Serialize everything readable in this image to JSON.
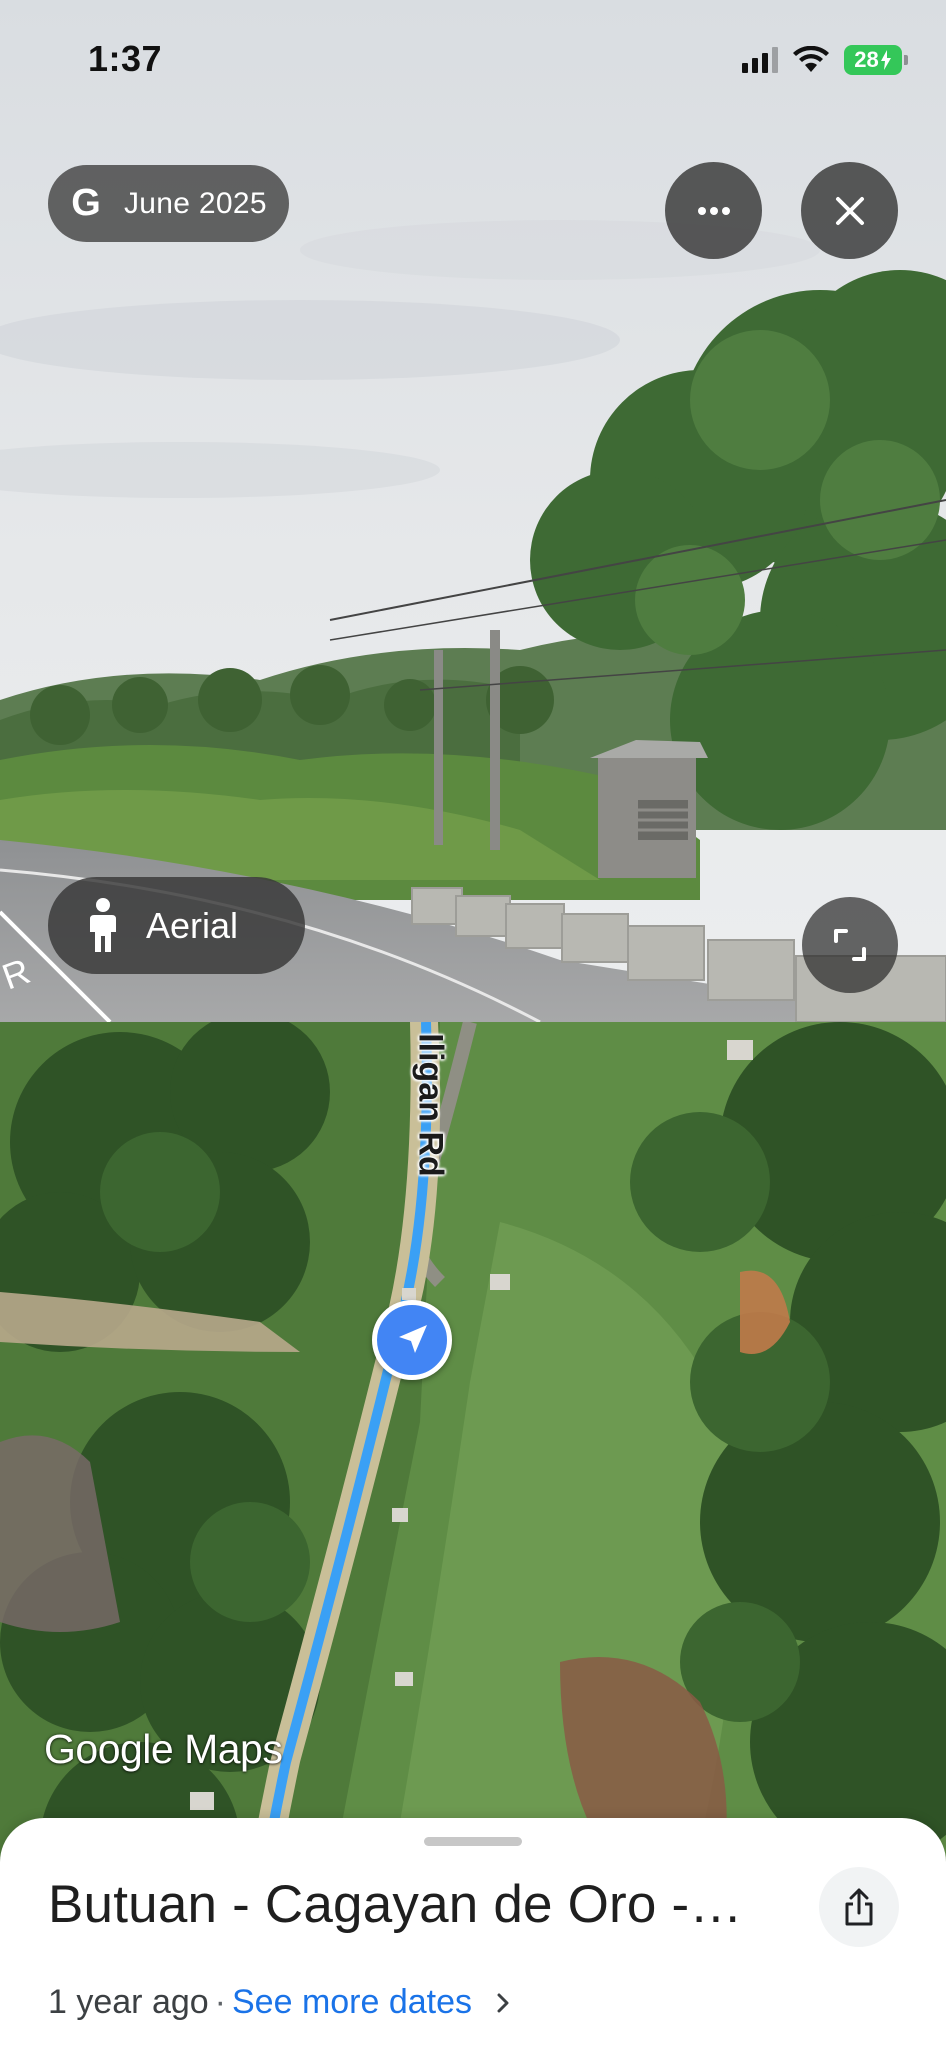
{
  "status_bar": {
    "time": "1:37",
    "battery": "28"
  },
  "street_view": {
    "date_chip_logo": "G",
    "date_chip_label": "June 2025",
    "more_icon": "more-horizontal-icon",
    "close_icon": "close-icon",
    "aerial_button_label": "Aerial",
    "expand_icon": "expand-icon"
  },
  "map": {
    "road_label": "Iligan Rd",
    "brand": "Google Maps",
    "route_color": "#3aa0f5",
    "puck_color": "#4285f4"
  },
  "sheet": {
    "title": "Butuan - Cagayan de Oro -…",
    "age": "1 year ago",
    "separator": "·",
    "see_more_label": "See more dates",
    "share_icon": "share-icon"
  }
}
